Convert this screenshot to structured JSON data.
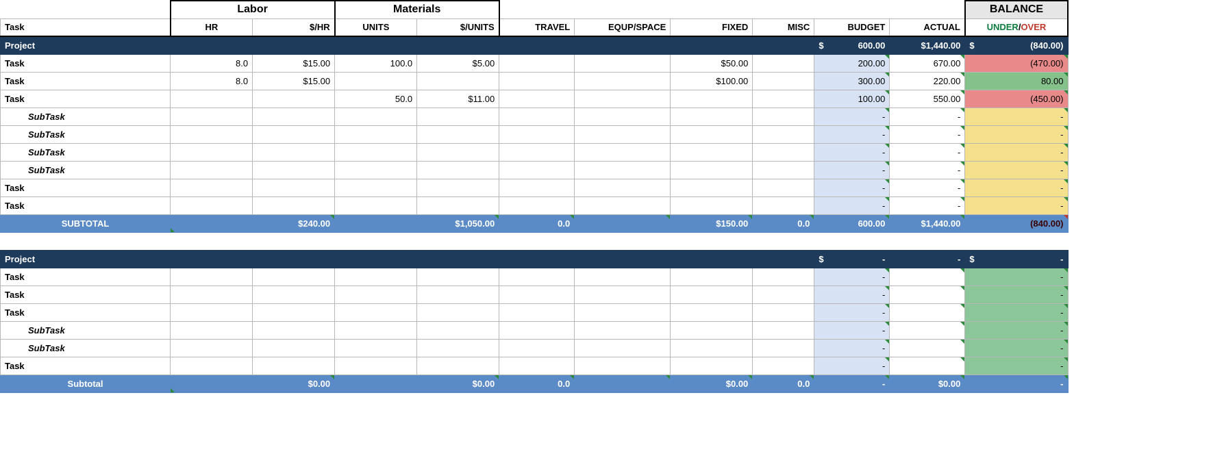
{
  "header": {
    "labor": "Labor",
    "materials": "Materials",
    "balance": "BALANCE",
    "under": "UNDER",
    "over": "OVER",
    "task": "Task",
    "hr": "HR",
    "dhr": "$/HR",
    "units": "UNITS",
    "dunits": "$/UNITS",
    "travel": "TRAVEL",
    "equp": "EQUP/SPACE",
    "fixed": "FIXED",
    "misc": "MISC",
    "budget": "BUDGET",
    "actual": "ACTUAL"
  },
  "sections": [
    {
      "project": {
        "label": "Project",
        "budget": "600.00",
        "actual": "$1,440.00",
        "balance": "(840.00)"
      },
      "rows": [
        {
          "type": "task",
          "label": "Task",
          "hr": "8.0",
          "dhr": "$15.00",
          "units": "100.0",
          "dunits": "$5.00",
          "travel": "",
          "equp": "",
          "fixed": "$50.00",
          "misc": "",
          "budget": "200.00",
          "actual": "670.00",
          "balance": "(470.00)",
          "balClass": "bal-red"
        },
        {
          "type": "task",
          "label": "Task",
          "hr": "8.0",
          "dhr": "$15.00",
          "units": "",
          "dunits": "",
          "travel": "",
          "equp": "",
          "fixed": "$100.00",
          "misc": "",
          "budget": "300.00",
          "actual": "220.00",
          "balance": "80.00",
          "balClass": "bal-green"
        },
        {
          "type": "task",
          "label": "Task",
          "hr": "",
          "dhr": "",
          "units": "50.0",
          "dunits": "$11.00",
          "travel": "",
          "equp": "",
          "fixed": "",
          "misc": "",
          "budget": "100.00",
          "actual": "550.00",
          "balance": "(450.00)",
          "balClass": "bal-red"
        },
        {
          "type": "subtask",
          "label": "SubTask",
          "hr": "",
          "dhr": "",
          "units": "",
          "dunits": "",
          "travel": "",
          "equp": "",
          "fixed": "",
          "misc": "",
          "budget": "-",
          "actual": "-",
          "balance": "-",
          "balClass": "bal-yellow"
        },
        {
          "type": "subtask",
          "label": "SubTask",
          "hr": "",
          "dhr": "",
          "units": "",
          "dunits": "",
          "travel": "",
          "equp": "",
          "fixed": "",
          "misc": "",
          "budget": "-",
          "actual": "-",
          "balance": "-",
          "balClass": "bal-yellow"
        },
        {
          "type": "subtask",
          "label": "SubTask",
          "hr": "",
          "dhr": "",
          "units": "",
          "dunits": "",
          "travel": "",
          "equp": "",
          "fixed": "",
          "misc": "",
          "budget": "-",
          "actual": "-",
          "balance": "-",
          "balClass": "bal-yellow"
        },
        {
          "type": "subtask",
          "label": "SubTask",
          "hr": "",
          "dhr": "",
          "units": "",
          "dunits": "",
          "travel": "",
          "equp": "",
          "fixed": "",
          "misc": "",
          "budget": "-",
          "actual": "-",
          "balance": "-",
          "balClass": "bal-yellow"
        },
        {
          "type": "task",
          "label": "Task",
          "hr": "",
          "dhr": "",
          "units": "",
          "dunits": "",
          "travel": "",
          "equp": "",
          "fixed": "",
          "misc": "",
          "budget": "-",
          "actual": "-",
          "balance": "-",
          "balClass": "bal-yellow"
        },
        {
          "type": "task",
          "label": "Task",
          "hr": "",
          "dhr": "",
          "units": "",
          "dunits": "",
          "travel": "",
          "equp": "",
          "fixed": "",
          "misc": "",
          "budget": "-",
          "actual": "-",
          "balance": "-",
          "balClass": "bal-yellow"
        }
      ],
      "subtotal": {
        "label": "SUBTOTAL",
        "dhr": "$240.00",
        "dunits": "$1,050.00",
        "travel": "0.0",
        "fixed": "$150.00",
        "misc": "0.0",
        "budget": "600.00",
        "actual": "$1,440.00",
        "balance": "(840.00)",
        "negBalance": true
      }
    },
    {
      "project": {
        "label": "Project",
        "budget": "-",
        "actual": "-",
        "balance": "-"
      },
      "rows": [
        {
          "type": "task",
          "label": "Task",
          "hr": "",
          "dhr": "",
          "units": "",
          "dunits": "",
          "travel": "",
          "equp": "",
          "fixed": "",
          "misc": "",
          "budget": "-",
          "actual": "",
          "balance": "-",
          "balClass": "bal-green2"
        },
        {
          "type": "task",
          "label": "Task",
          "hr": "",
          "dhr": "",
          "units": "",
          "dunits": "",
          "travel": "",
          "equp": "",
          "fixed": "",
          "misc": "",
          "budget": "-",
          "actual": "",
          "balance": "-",
          "balClass": "bal-green2"
        },
        {
          "type": "task",
          "label": "Task",
          "hr": "",
          "dhr": "",
          "units": "",
          "dunits": "",
          "travel": "",
          "equp": "",
          "fixed": "",
          "misc": "",
          "budget": "-",
          "actual": "",
          "balance": "-",
          "balClass": "bal-green2"
        },
        {
          "type": "subtask",
          "label": "SubTask",
          "hr": "",
          "dhr": "",
          "units": "",
          "dunits": "",
          "travel": "",
          "equp": "",
          "fixed": "",
          "misc": "",
          "budget": "-",
          "actual": "",
          "balance": "-",
          "balClass": "bal-green2"
        },
        {
          "type": "subtask",
          "label": "SubTask",
          "hr": "",
          "dhr": "",
          "units": "",
          "dunits": "",
          "travel": "",
          "equp": "",
          "fixed": "",
          "misc": "",
          "budget": "-",
          "actual": "",
          "balance": "-",
          "balClass": "bal-green2"
        },
        {
          "type": "task",
          "label": "Task",
          "hr": "",
          "dhr": "",
          "units": "",
          "dunits": "",
          "travel": "",
          "equp": "",
          "fixed": "",
          "misc": "",
          "budget": "-",
          "actual": "",
          "balance": "-",
          "balClass": "bal-green2"
        }
      ],
      "subtotal": {
        "label": "Subtotal",
        "dhr": "$0.00",
        "dunits": "$0.00",
        "travel": "0.0",
        "fixed": "$0.00",
        "misc": "0.0",
        "budget": "-",
        "actual": "$0.00",
        "balance": "-",
        "negBalance": false
      }
    }
  ]
}
